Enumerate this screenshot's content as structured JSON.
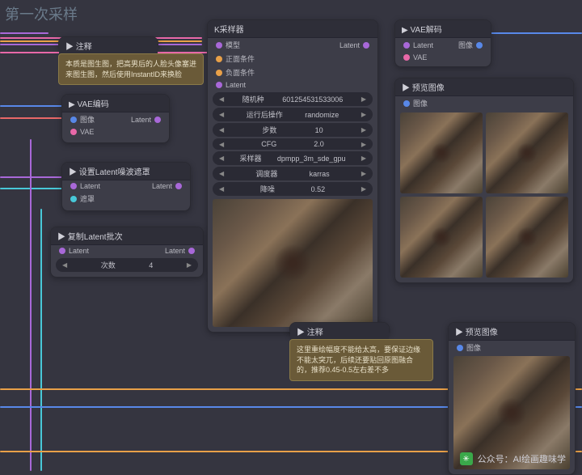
{
  "title": "第一次采样",
  "tooltip1": "本质是图生图，把高男后的人脸头像塞进来图生图，然后使用InstantID来换脸",
  "tooltip2": "这里重绘幅度不能给太高，要保证边缘不能太突兀，后续还要贴回原图融合的，推荐0.45-0.5左右差不多",
  "annotation": {
    "title": "▶ 注释"
  },
  "vae_encode": {
    "title": "▶ VAE编码",
    "image": "图像",
    "latent": "Latent",
    "vae": "VAE"
  },
  "set_mask": {
    "title": "▶ 设置Latent噪波遮罩",
    "latent_in": "Latent",
    "latent_out": "Latent",
    "mask": "遮罩"
  },
  "repeat_latent": {
    "title": "▶ 复制Latent批次",
    "latent_in": "Latent",
    "latent_out": "Latent",
    "count_label": "次数",
    "count_val": "4"
  },
  "ksampler": {
    "title": "K采样器",
    "model": "模型",
    "positive": "正面条件",
    "negative": "负面条件",
    "latent": "Latent",
    "params": [
      {
        "k": "随机种",
        "v": "601254531533006"
      },
      {
        "k": "运行后操作",
        "v": "randomize"
      },
      {
        "k": "步数",
        "v": "10"
      },
      {
        "k": "CFG",
        "v": "2.0"
      },
      {
        "k": "采样器",
        "v": "dpmpp_3m_sde_gpu"
      },
      {
        "k": "调度器",
        "v": "karras"
      },
      {
        "k": "降噪",
        "v": "0.52"
      }
    ]
  },
  "vae_decode": {
    "title": "▶ VAE解码",
    "latent": "Latent",
    "image": "图像",
    "vae": "VAE"
  },
  "preview": {
    "title": "▶ 预览图像",
    "image": "图像"
  },
  "watermark": {
    "label": "公众号：",
    "name": "AI绘画趣味学"
  }
}
